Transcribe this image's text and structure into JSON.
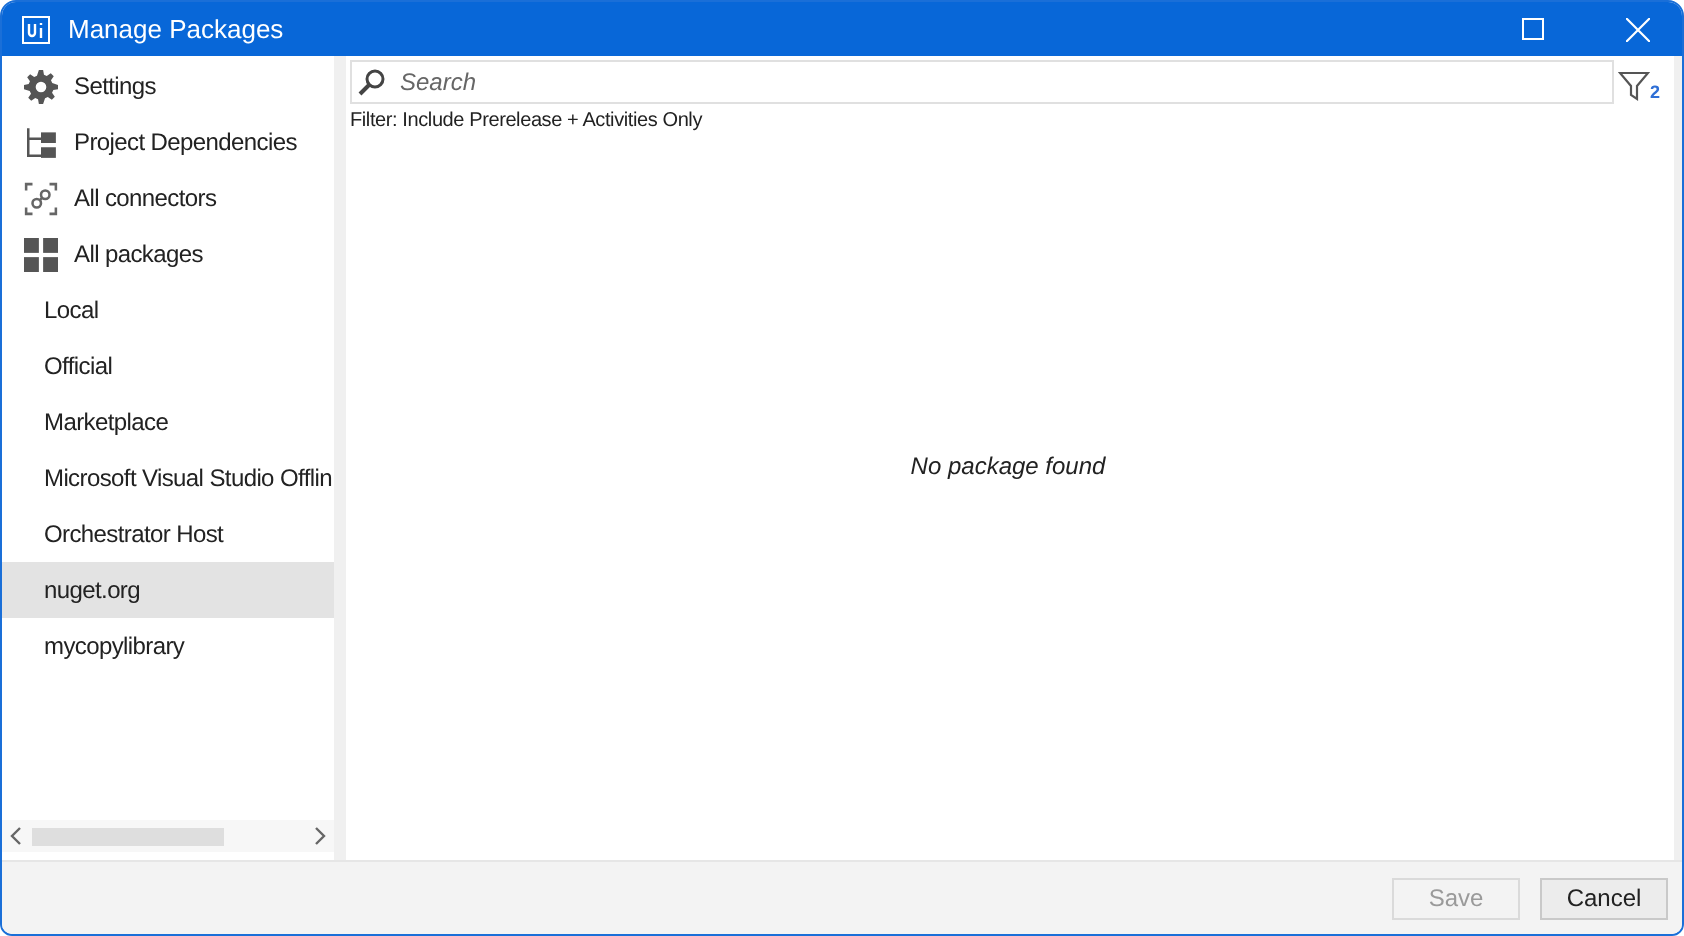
{
  "window": {
    "title": "Manage Packages"
  },
  "sidebar": {
    "items": [
      {
        "label": "Settings",
        "kind": "settings",
        "selected": false
      },
      {
        "label": "Project Dependencies",
        "kind": "dependencies",
        "selected": false
      },
      {
        "label": "All connectors",
        "kind": "connectors",
        "selected": false
      },
      {
        "label": "All packages",
        "kind": "packages",
        "selected": false
      },
      {
        "label": "Local",
        "kind": "source",
        "selected": false
      },
      {
        "label": "Official",
        "kind": "source",
        "selected": false
      },
      {
        "label": "Marketplace",
        "kind": "source",
        "selected": false
      },
      {
        "label": "Microsoft Visual Studio Offlin",
        "kind": "source",
        "selected": false
      },
      {
        "label": "Orchestrator Host",
        "kind": "source",
        "selected": false
      },
      {
        "label": "nuget.org",
        "kind": "source",
        "selected": true
      },
      {
        "label": "mycopylibrary",
        "kind": "source",
        "selected": false
      }
    ]
  },
  "search": {
    "placeholder": "Search"
  },
  "filter": {
    "count": "2",
    "summary": "Filter: Include Prerelease + Activities Only"
  },
  "empty_message": "No package found",
  "buttons": [
    {
      "label": "Save",
      "disabled": true
    },
    {
      "label": "Cancel",
      "disabled": false
    }
  ]
}
